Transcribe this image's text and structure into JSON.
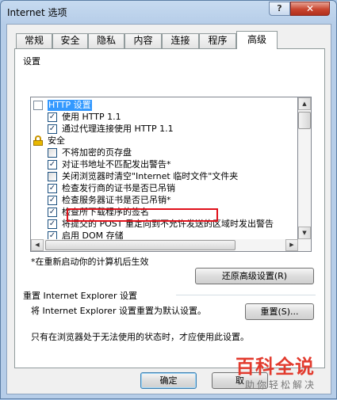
{
  "window": {
    "title": "Internet 选项",
    "help_label": "?",
    "close_label": "✕"
  },
  "tabs": [
    {
      "label": "常规"
    },
    {
      "label": "安全"
    },
    {
      "label": "隐私"
    },
    {
      "label": "内容"
    },
    {
      "label": "连接"
    },
    {
      "label": "程序"
    },
    {
      "label": "高级",
      "active": true
    }
  ],
  "settings": {
    "group_label": "设置",
    "items": [
      {
        "type": "folder",
        "label": "HTTP 设置",
        "selected": true
      },
      {
        "type": "checkbox",
        "checked": true,
        "label": "使用 HTTP 1.1"
      },
      {
        "type": "checkbox",
        "checked": true,
        "label": "通过代理连接使用 HTTP 1.1"
      },
      {
        "type": "lock",
        "label": "安全"
      },
      {
        "type": "checkbox",
        "checked": false,
        "label": "不将加密的页存盘"
      },
      {
        "type": "checkbox",
        "checked": true,
        "label": "对证书地址不匹配发出警告*"
      },
      {
        "type": "checkbox",
        "checked": false,
        "label": "关闭浏览器时清空\"Internet 临时文件\"文件夹"
      },
      {
        "type": "checkbox",
        "checked": true,
        "label": "检查发行商的证书是否已吊销",
        "highlighted": true
      },
      {
        "type": "checkbox",
        "checked": true,
        "label": "检查服务器证书是否已吊销*"
      },
      {
        "type": "checkbox",
        "checked": true,
        "label": "检查所下载程序的签名"
      },
      {
        "type": "checkbox",
        "checked": true,
        "label": "将提交的 POST 重定向到不允许发送的区域时发出警告"
      },
      {
        "type": "checkbox",
        "checked": true,
        "label": "启用 DOM 存储"
      }
    ],
    "restart_note": "*在重新启动你的计算机后生效",
    "restore_button": "还原高级设置(R)"
  },
  "reset": {
    "group_label": "重置 Internet Explorer 设置",
    "description": "将 Internet Explorer 设置重置为默认设置。",
    "reset_button": "重置(S)...",
    "note": "只有在浏览器处于无法使用的状态时，才应使用此设置。"
  },
  "footer": {
    "ok_button": "确定",
    "cancel_button": "取"
  },
  "watermark": {
    "title": "百科全说",
    "subtitle": "助你轻松解决"
  }
}
